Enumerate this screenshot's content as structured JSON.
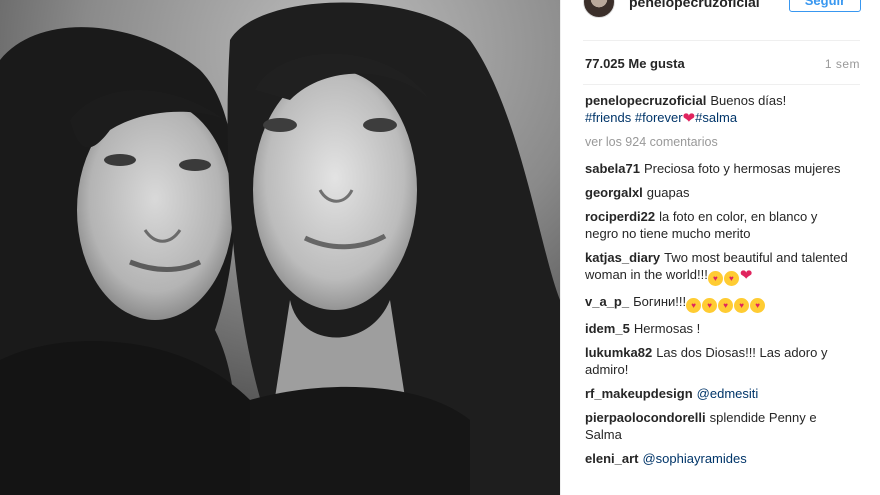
{
  "header": {
    "username": "penelopecruzoficial",
    "follow_label": "Seguir"
  },
  "post": {
    "likes": "77.025 Me gusta",
    "age": "1 sem"
  },
  "caption": {
    "user": "penelopecruzoficial",
    "text": "Buenos días!",
    "hashtags": [
      "#friends",
      "#forever",
      "#salma"
    ]
  },
  "view_comments": "ver los 924 comentarios",
  "comments": [
    {
      "user": "sabela71",
      "text": "Preciosa foto y hermosas mujeres"
    },
    {
      "user": "georgalxl",
      "text": "guapas"
    },
    {
      "user": "rociperdi22",
      "text": "la foto en color, en blanco y negro no tiene mucho merito"
    },
    {
      "user": "katjas_diary",
      "text": "Two most beautiful and talented woman in the world!!!"
    },
    {
      "user": "v_a_p_",
      "text": "Богини!!!"
    },
    {
      "user": "idem_5",
      "text": "Hermosas !"
    },
    {
      "user": "lukumka82",
      "text": "Las dos Diosas!!! Las adoro y admiro!"
    },
    {
      "user": "rf_makeupdesign",
      "text": "@edmesiti"
    },
    {
      "user": "pierpaolocondorelli",
      "text": "splendide Penny e Salma"
    },
    {
      "user": "eleni_art",
      "text": "@sophiayramides"
    }
  ],
  "colors": {
    "link": "#003569",
    "accent": "#3897f0",
    "heart": "#ed4956"
  }
}
